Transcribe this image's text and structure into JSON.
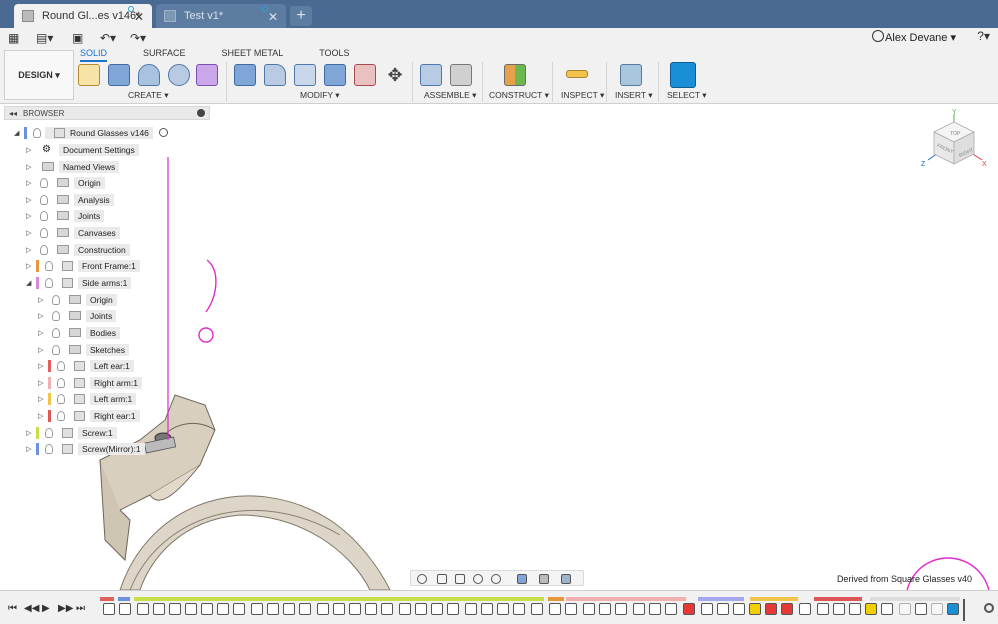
{
  "tabs": [
    {
      "title": "Round Gl...es v146*",
      "active": true
    },
    {
      "title": "Test v1*",
      "active": false
    }
  ],
  "quick_access": {
    "user_name": "Alex Devane",
    "help": "?"
  },
  "toolbar": {
    "workspace": "DESIGN ▾",
    "ribbon_tabs": [
      "SOLID",
      "SURFACE",
      "SHEET METAL",
      "TOOLS"
    ],
    "groups": [
      "CREATE ▾",
      "MODIFY ▾",
      "ASSEMBLE ▾",
      "CONSTRUCT ▾",
      "INSPECT ▾",
      "INSERT ▾",
      "SELECT ▾"
    ]
  },
  "browser": {
    "title": "BROWSER",
    "root": "Round Glasses v146",
    "items": [
      {
        "label": "Document Settings",
        "icon": "gear-icon"
      },
      {
        "label": "Named Views",
        "icon": "folder-icon"
      },
      {
        "label": "Origin",
        "icon": "folder-icon"
      },
      {
        "label": "Analysis",
        "icon": "folder-icon"
      },
      {
        "label": "Joints",
        "icon": "folder-icon"
      },
      {
        "label": "Canvases",
        "icon": "folder-icon"
      },
      {
        "label": "Construction",
        "icon": "folder-icon"
      },
      {
        "label": "Front Frame:1",
        "icon": "component-icon",
        "color": "#e8963a"
      },
      {
        "label": "Side arms:1",
        "icon": "component-icon",
        "color": "#d98ad3"
      },
      {
        "label": "Origin",
        "icon": "folder-icon"
      },
      {
        "label": "Joints",
        "icon": "folder-icon"
      },
      {
        "label": "Bodies",
        "icon": "folder-icon"
      },
      {
        "label": "Sketches",
        "icon": "folder-icon"
      },
      {
        "label": "Left ear:1",
        "icon": "component-icon",
        "color": "#e06060"
      },
      {
        "label": "Right arm:1",
        "icon": "component-icon",
        "color": "#f0b0b0"
      },
      {
        "label": "Left arm:1",
        "icon": "component-icon",
        "color": "#f2c34a"
      },
      {
        "label": "Right ear:1",
        "icon": "component-icon",
        "color": "#e05555"
      },
      {
        "label": "Screw:1",
        "icon": "component-icon",
        "color": "#c7e04a"
      },
      {
        "label": "Screw(Mirror):1",
        "icon": "component-icon",
        "color": "#6f8fe0"
      }
    ]
  },
  "viewcube": {
    "top": "TOP",
    "front": "FRONT",
    "right": "RIGHT",
    "axis_x": "X",
    "axis_y": "Y",
    "axis_z": "Z"
  },
  "status_text": "Derived from Square Glasses v40",
  "colors": {
    "accent": "#1a73c9",
    "tabbar": "#4a6a91",
    "sketch": "#e02ad0"
  }
}
